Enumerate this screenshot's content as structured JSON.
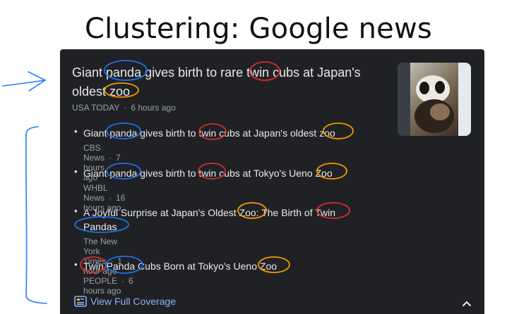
{
  "slide": {
    "title": "Clustering: Google news"
  },
  "card": {
    "lead": {
      "headline": "Giant panda gives birth to rare twin cubs at Japan's oldest zoo",
      "source": "USA TODAY",
      "time": "6 hours ago"
    },
    "stories": [
      {
        "title": "Giant panda gives birth to twin cubs at Japan's oldest zoo",
        "source": "CBS News",
        "time": "7 hours ago"
      },
      {
        "title": "Giant panda gives birth to twin cubs at Tokyo's Ueno Zoo",
        "source": "WHBL News",
        "time": "16 hours ago"
      },
      {
        "title": "A Joyful Surprise at Japan's Oldest Zoo: The Birth of Twin Pandas",
        "source": "The New York Times",
        "time": "1 hour ago"
      },
      {
        "title": "Twin Panda Cubs Born at Tokyo's Ueno Zoo",
        "source": "PEOPLE",
        "time": "6 hours ago"
      }
    ],
    "full_coverage_label": "View Full Coverage",
    "separator": "·"
  },
  "colors": {
    "card_bg": "#202124",
    "panda_circle": "#1a73e8",
    "twin_circle": "#d32f2f",
    "zoo_circle": "#f29900",
    "annotation": "#2979ff",
    "link": "#8ab4f8"
  },
  "icons": [
    "arrow-annotation",
    "bracket-annotation",
    "full-coverage-icon",
    "chevron-up-icon",
    "thumbnail-image"
  ]
}
